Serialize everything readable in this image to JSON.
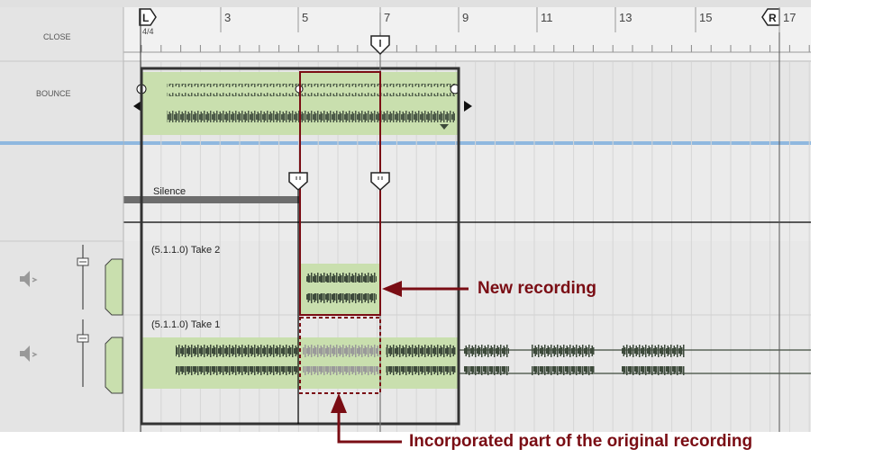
{
  "header": {
    "close_label": "CLOSE"
  },
  "bounce": {
    "label": "BOUNCE"
  },
  "ruler": {
    "bar_numbers": [
      "3",
      "5",
      "7",
      "9",
      "11",
      "13",
      "15",
      "17"
    ],
    "time_signature": "4/4",
    "left_locator": "L",
    "right_locator": "R"
  },
  "silence_lane": {
    "label": "Silence"
  },
  "takes": [
    {
      "label": "(5.1.1.0) Take 2"
    },
    {
      "label": "(5.1.1.0) Take 1"
    }
  ],
  "annotations": {
    "new_recording": "New recording",
    "incorporated": "Incorporated part of the original recording"
  },
  "colors": {
    "clip_green": "#c9dfae",
    "waveform": "#3d4a3b",
    "waveform_muted": "#9a9a9a",
    "callout_red": "#7a0d14",
    "lane_divider_blue": "#8fb8df"
  },
  "icons": {
    "speaker": "speaker-icon",
    "fader": "fader-icon",
    "punch": "punch-marker-icon",
    "play_cursor": "song-position-marker-icon"
  }
}
